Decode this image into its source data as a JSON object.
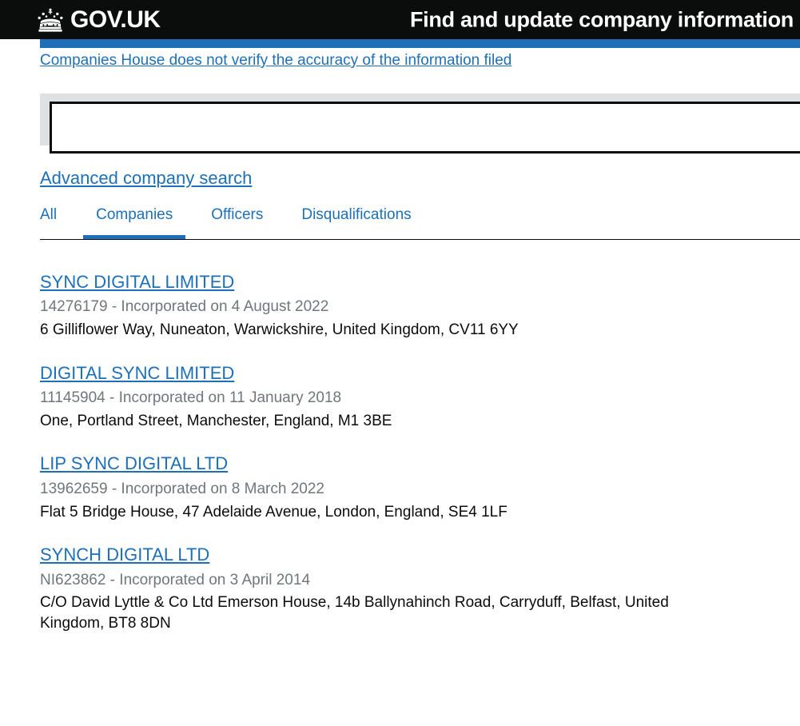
{
  "header": {
    "logo_text": "GOV.UK",
    "crown_icon": "crown-icon",
    "service_name": "Find and update company information"
  },
  "phase_banner": {
    "link_text": "Companies House does not verify the accuracy of the information filed"
  },
  "search": {
    "value": "",
    "placeholder": ""
  },
  "advanced_search": {
    "label": "Advanced company search"
  },
  "tabs": [
    {
      "label": "All",
      "active": false
    },
    {
      "label": "Companies",
      "active": true
    },
    {
      "label": "Officers",
      "active": false
    },
    {
      "label": "Disqualifications",
      "active": false
    }
  ],
  "results": [
    {
      "name": "SYNC DIGITAL LIMITED",
      "meta": "14276179 - Incorporated on 4 August 2022",
      "address": "6 Gilliflower Way, Nuneaton, Warwickshire, United Kingdom, CV11 6YY"
    },
    {
      "name": "DIGITAL SYNC LIMITED",
      "meta": "11145904 - Incorporated on 11 January 2018",
      "address": "One, Portland Street, Manchester, England, M1 3BE"
    },
    {
      "name": "LIP SYNC DIGITAL LTD",
      "meta": "13962659 - Incorporated on 8 March 2022",
      "address": "Flat 5 Bridge House, 47 Adelaide Avenue, London, England, SE4 1LF"
    },
    {
      "name": "SYNCH DIGITAL LTD",
      "meta": "NI623862 - Incorporated on 3 April 2014",
      "address": "C/O David Lyttle & Co Ltd Emerson House, 14b Ballynahinch Road, Carryduff, Belfast, United Kingdom, BT8 8DN"
    }
  ],
  "colors": {
    "header_background": "#0b0c0c",
    "link_blue": "#1d70b8",
    "phase_strip": "#1d70b8",
    "panel_grey": "#dee0e2",
    "meta_grey": "#6f777b",
    "body_text": "#0b0c0c"
  }
}
